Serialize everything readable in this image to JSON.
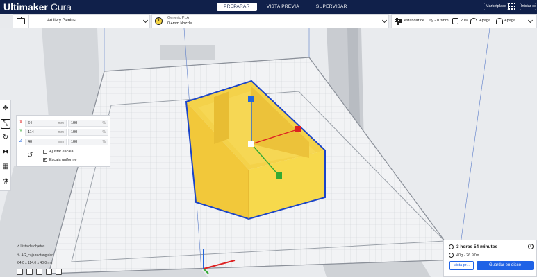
{
  "app": {
    "title_bold": "Ultimaker",
    "title_light": "Cura"
  },
  "stages": [
    "PREPARAR",
    "VISTA PREVIA",
    "SUPERVISAR"
  ],
  "topbar": {
    "marketplace": "Marketplace",
    "signin": "Iniciar sesión"
  },
  "machine": {
    "name": "Artillery Genius"
  },
  "material": {
    "extruder_index": "1",
    "name": "Generic PLA",
    "nozzle": "0.4mm Nozzle"
  },
  "print_settings": {
    "profile": "estandar de ...lity - 0.3mm",
    "infill": "20%",
    "support": "Apaga...",
    "adhesion": "Apaga..."
  },
  "scale_tool": {
    "rows": [
      {
        "axis": "X",
        "mm": "64",
        "percent": "100",
        "mm_unit": "mm",
        "pct_unit": "%"
      },
      {
        "axis": "Y",
        "mm": "114",
        "percent": "100",
        "mm_unit": "mm",
        "pct_unit": "%"
      },
      {
        "axis": "Z",
        "mm": "40",
        "percent": "100",
        "mm_unit": "mm",
        "pct_unit": "%"
      }
    ],
    "snap_label": "Ajustar escala",
    "snap_checked": false,
    "uniform_label": "Escala uniforme",
    "uniform_checked": true
  },
  "objects": {
    "header": "Lista de objetos",
    "name": "AG_caja rectangular",
    "dims": "64.0 x 114.0 x 40.0 mm"
  },
  "print_panel": {
    "time": "3 horas 54 minutos",
    "material_usage": "40g · 26.97m",
    "preview_button": "Vista pr...",
    "save_button": "Guardar en disco"
  },
  "colors": {
    "topbar": "#10204a",
    "accent": "#1f62e6",
    "model": "#f7d94c",
    "model_outline": "#1b44c8",
    "axis_x": "#dd2222",
    "axis_y": "#33aa33",
    "axis_z": "#2266dd"
  }
}
